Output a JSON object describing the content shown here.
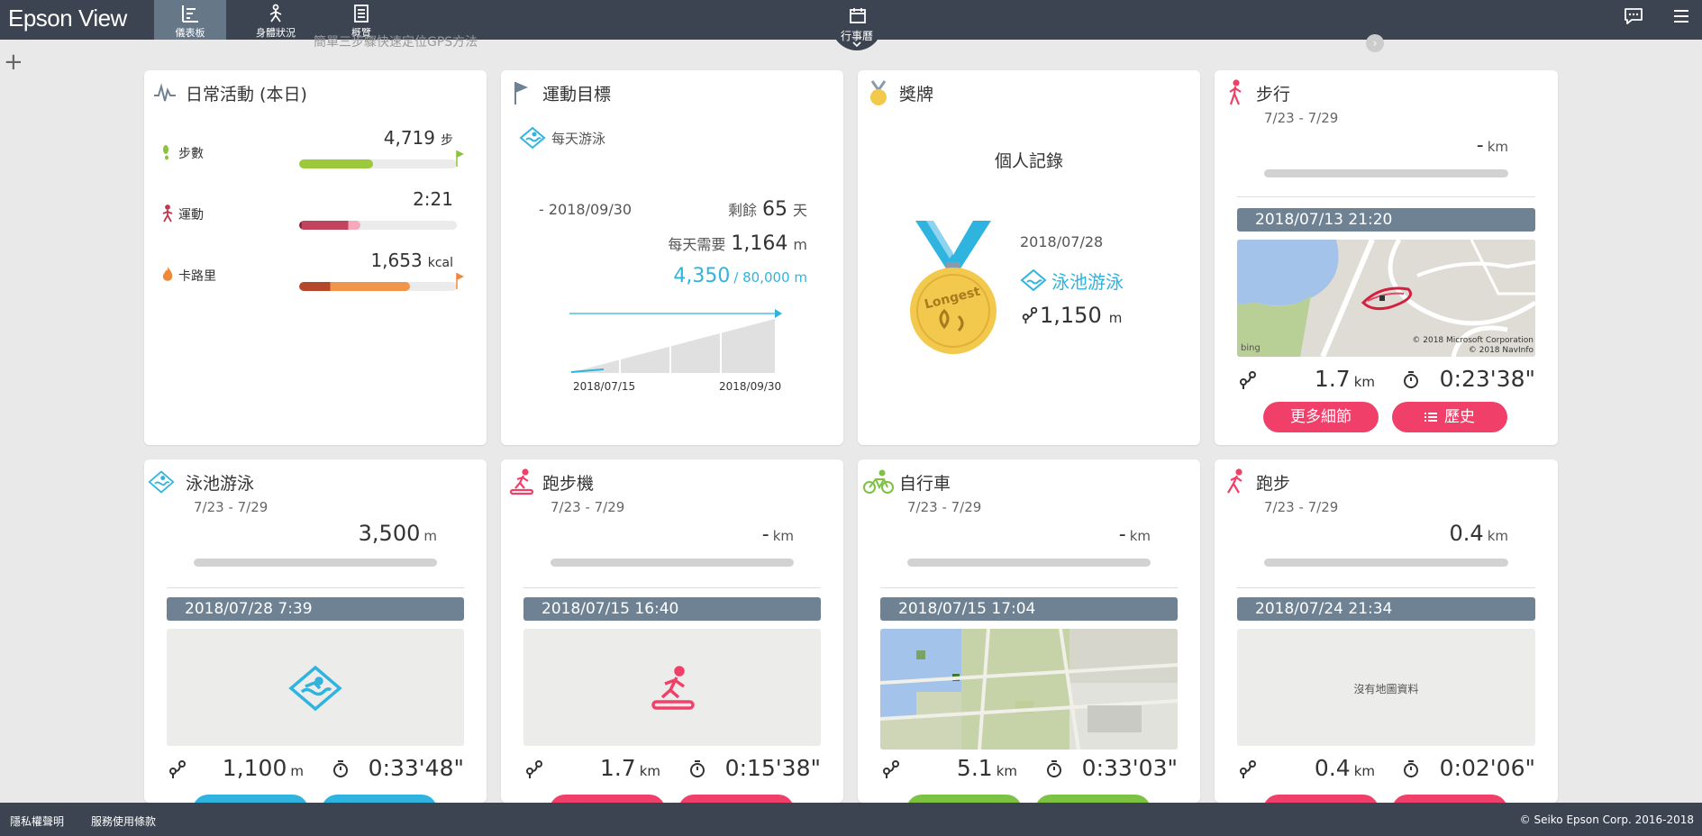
{
  "app": {
    "brand": "Epson View"
  },
  "nav": {
    "tabs": [
      {
        "label": "儀表板"
      },
      {
        "label": "身體狀況"
      },
      {
        "label": "概覽"
      }
    ],
    "calendar": "行事曆"
  },
  "notice": "簡單三步驟快速定位GPS方法",
  "daily": {
    "title": "日常活動 (本日)",
    "steps": {
      "label": "步數",
      "value": "4,719",
      "unit": "步",
      "progress": 0.47
    },
    "exercise": {
      "label": "運動",
      "value": "2:21",
      "progress": 0.39
    },
    "calories": {
      "label": "卡路里",
      "value": "1,653",
      "unit": "kcal",
      "progress": 0.7
    }
  },
  "goal": {
    "title": "運動目標",
    "subtitle": "每天游泳",
    "deadline": "- 2018/09/30",
    "remaining_prefix": "剩餘",
    "remaining_value": "65",
    "remaining_unit": "天",
    "daily_prefix": "每天需要",
    "daily_value": "1,164",
    "daily_unit": "m",
    "progress_value": "4,350",
    "progress_total": "/ 80,000 m",
    "chart_start": "2018/07/15",
    "chart_end": "2018/09/30"
  },
  "medal": {
    "title": "獎牌",
    "record_label": "個人記錄",
    "medal_text": "Longest",
    "date": "2018/07/28",
    "activity": "泳池游泳",
    "distance": "1,150",
    "unit": "m"
  },
  "cards": {
    "walk": {
      "title": "步行",
      "range": "7/23 - 7/29",
      "summary": "-",
      "summary_unit": "km",
      "date": "2018/07/13 21:20",
      "distance": "1.7",
      "distance_unit": "km",
      "time": "0:23'38\"",
      "map_credit1": "© 2018 Microsoft Corporation",
      "map_credit2": "© 2018 NavInfo",
      "map_brand": "bing",
      "btn_more": "更多細節",
      "btn_history": "歷史"
    },
    "swim": {
      "title": "泳池游泳",
      "range": "7/23 - 7/29",
      "summary": "3,500",
      "summary_unit": "m",
      "date": "2018/07/28 7:39",
      "distance": "1,100",
      "distance_unit": "m",
      "time": "0:33'48\""
    },
    "treadmill": {
      "title": "跑步機",
      "range": "7/23 - 7/29",
      "summary": "-",
      "summary_unit": "km",
      "date": "2018/07/15 16:40",
      "distance": "1.7",
      "distance_unit": "km",
      "time": "0:15'38\""
    },
    "bike": {
      "title": "自行車",
      "range": "7/23 - 7/29",
      "summary": "-",
      "summary_unit": "km",
      "date": "2018/07/15 17:04",
      "distance": "5.1",
      "distance_unit": "km",
      "time": "0:33'03\""
    },
    "run": {
      "title": "跑步",
      "range": "7/23 - 7/29",
      "summary": "0.4",
      "summary_unit": "km",
      "date": "2018/07/24 21:34",
      "no_map": "沒有地圖資料",
      "distance": "0.4",
      "distance_unit": "km",
      "time": "0:02'06\""
    }
  },
  "footer": {
    "privacy": "隱私權聲明",
    "terms": "服務使用條款",
    "copyright": "© Seiko Epson Corp. 2016-2018"
  },
  "colors": {
    "topbar": "#3b4450",
    "pink": "#f0406a",
    "blue": "#2fb4e0",
    "green": "#7dc242",
    "pill": "#6f8294"
  }
}
